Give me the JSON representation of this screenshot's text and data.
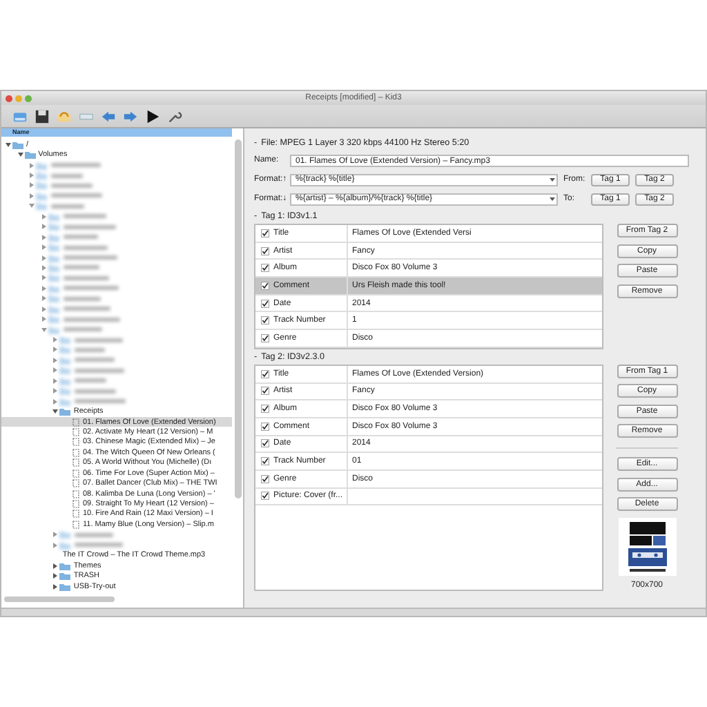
{
  "window": {
    "title": "Receipts [modified] – Kid3"
  },
  "file_tree": {
    "column": "Name",
    "items": [
      {
        "kind": "folder",
        "label": "/",
        "expanded": true,
        "children": [
          {
            "kind": "folder",
            "label": "Volumes",
            "expanded": true,
            "children": [
              {
                "kind": "blurred",
                "expanded": false
              },
              {
                "kind": "blurred",
                "expanded": false
              },
              {
                "kind": "blurred",
                "expanded": false
              },
              {
                "kind": "blurred",
                "expanded": false
              },
              {
                "kind": "blurred",
                "expanded": true,
                "children": [
                  {
                    "kind": "blurred",
                    "expanded": false
                  },
                  {
                    "kind": "blurred",
                    "expanded": false
                  },
                  {
                    "kind": "blurred",
                    "expanded": false
                  },
                  {
                    "kind": "blurred",
                    "expanded": false
                  },
                  {
                    "kind": "blurred",
                    "expanded": false
                  },
                  {
                    "kind": "blurred",
                    "expanded": false
                  },
                  {
                    "kind": "blurred",
                    "expanded": false
                  },
                  {
                    "kind": "blurred",
                    "expanded": false
                  },
                  {
                    "kind": "blurred",
                    "expanded": false
                  },
                  {
                    "kind": "blurred",
                    "expanded": false
                  },
                  {
                    "kind": "blurred",
                    "expanded": false
                  },
                  {
                    "kind": "blurred",
                    "expanded": true,
                    "children": [
                      {
                        "kind": "blurred",
                        "expanded": false
                      },
                      {
                        "kind": "blurred",
                        "expanded": false
                      },
                      {
                        "kind": "blurred",
                        "expanded": false
                      },
                      {
                        "kind": "blurred",
                        "expanded": false
                      },
                      {
                        "kind": "blurred",
                        "expanded": false
                      },
                      {
                        "kind": "blurred",
                        "expanded": false
                      },
                      {
                        "kind": "blurred",
                        "expanded": false
                      },
                      {
                        "kind": "folder",
                        "label": "Receipts",
                        "expanded": true,
                        "children": [
                          {
                            "kind": "file",
                            "label": "01. Flames Of Love (Extended Version)",
                            "selected": true
                          },
                          {
                            "kind": "file",
                            "label": "02. Activate My Heart (12 Version) – M",
                            "selected": false
                          },
                          {
                            "kind": "file",
                            "label": "03. Chinese Magic (Extended Mix) – Je",
                            "selected": false
                          },
                          {
                            "kind": "file",
                            "label": "04. The Witch Queen Of New Orleans (",
                            "selected": false
                          },
                          {
                            "kind": "file",
                            "label": "05. A World Without You (Michelle) (Dı",
                            "selected": false
                          },
                          {
                            "kind": "file",
                            "label": "06. Time For Love (Super Action Mix) –",
                            "selected": false
                          },
                          {
                            "kind": "file",
                            "label": "07. Ballet Dancer (Club Mix) – THE TWI",
                            "selected": false
                          },
                          {
                            "kind": "file",
                            "label": "08. Kalimba De Luna (Long Version) – '",
                            "selected": false
                          },
                          {
                            "kind": "file",
                            "label": "09. Straight To My Heart (12 Version) –",
                            "selected": false
                          },
                          {
                            "kind": "file",
                            "label": "10. Fire And Rain (12 Maxi Version) – I",
                            "selected": false
                          },
                          {
                            "kind": "file",
                            "label": "11. Mamy Blue (Long Version) – Slip.m",
                            "selected": false
                          }
                        ]
                      },
                      {
                        "kind": "blurred",
                        "expanded": false
                      },
                      {
                        "kind": "blurred",
                        "expanded": false
                      },
                      {
                        "kind": "plainfile",
                        "label": "The IT Crowd – The IT Crowd Theme.mp3",
                        "selected": false
                      },
                      {
                        "kind": "folder",
                        "label": "Themes",
                        "expanded": false
                      },
                      {
                        "kind": "folder",
                        "label": "TRASH",
                        "expanded": false
                      },
                      {
                        "kind": "folder",
                        "label": "USB-Try-out",
                        "expanded": false
                      }
                    ]
                  }
                ]
              }
            ]
          }
        ]
      }
    ]
  },
  "file_section": {
    "toggle": "-",
    "title": "File: MPEG 1 Layer 3 320 kbps 44100 Hz Stereo 5:20"
  },
  "name": {
    "label": "Name:",
    "value": "01. Flames Of Love (Extended Version) – Fancy.mp3"
  },
  "formats": [
    {
      "label": "Format:↑",
      "value": "%{track} %{title}",
      "direction_label": "From:",
      "buttons": [
        "Tag 1",
        "Tag 2"
      ]
    },
    {
      "label": "Format:↓",
      "value": "%{artist} – %{album}/%{track} %{title}",
      "direction_label": "To:",
      "buttons": [
        "Tag 1",
        "Tag 2"
      ]
    }
  ],
  "tags": [
    {
      "toggle": "-",
      "title": "Tag 1: ID3v1.1",
      "frames": [
        {
          "name": "Title",
          "value": "Flames Of Love (Extended Versi",
          "checked": true,
          "selected": false
        },
        {
          "name": "Artist",
          "value": "Fancy",
          "checked": true,
          "selected": false
        },
        {
          "name": "Album",
          "value": "Disco Fox 80 Volume 3",
          "checked": true,
          "selected": false
        },
        {
          "name": "Comment",
          "value": "Urs Fleish made this tool!",
          "checked": true,
          "selected": true
        },
        {
          "name": "Date",
          "value": "2014",
          "checked": true,
          "selected": false
        },
        {
          "name": "Track Number",
          "value": "1",
          "checked": true,
          "selected": false
        },
        {
          "name": "Genre",
          "value": "Disco",
          "checked": true,
          "selected": false
        }
      ],
      "buttons": [
        "From Tag 2",
        "Copy",
        "Paste",
        "Remove"
      ]
    },
    {
      "toggle": "-",
      "title": "Tag 2: ID3v2.3.0",
      "frames": [
        {
          "name": "Title",
          "value": "Flames Of Love (Extended Version)",
          "checked": true,
          "selected": false
        },
        {
          "name": "Artist",
          "value": "Fancy",
          "checked": true,
          "selected": false
        },
        {
          "name": "Album",
          "value": "Disco Fox 80 Volume 3",
          "checked": true,
          "selected": false
        },
        {
          "name": "Comment",
          "value": "Disco Fox 80 Volume 3",
          "checked": true,
          "selected": false
        },
        {
          "name": "Date",
          "value": "2014",
          "checked": true,
          "selected": false
        },
        {
          "name": "Track Number",
          "value": "01",
          "checked": true,
          "selected": false
        },
        {
          "name": "Genre",
          "value": "Disco",
          "checked": true,
          "selected": false
        },
        {
          "name": "Picture: Cover (fr...",
          "checked": true,
          "selected": false
        }
      ],
      "buttons": [
        "From Tag 1",
        "Copy",
        "Paste",
        "Remove"
      ],
      "extra_buttons": [
        "Edit...",
        "Add...",
        "Delete"
      ],
      "cover": {
        "kind": "picture",
        "size": "700x700"
      }
    }
  ]
}
